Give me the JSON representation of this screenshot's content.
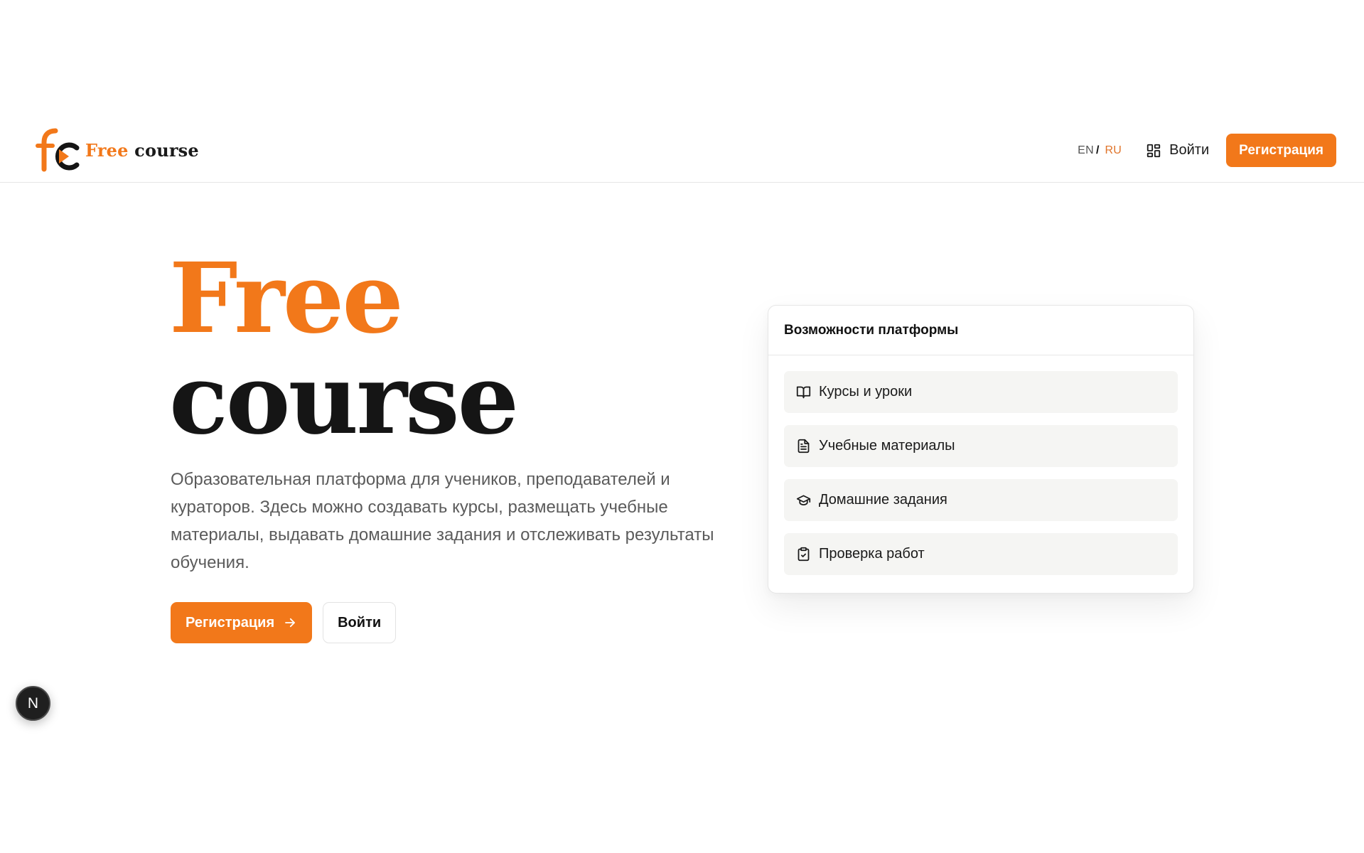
{
  "colors": {
    "accent": "#f2781a",
    "text": "#1a1a1a",
    "muted": "#5b5b5b",
    "border": "#e6e6e6",
    "feature_bg": "#f5f5f3"
  },
  "header": {
    "logo": {
      "word1": "Free",
      "word2": "course",
      "icon": "fc-logo-icon"
    },
    "lang": {
      "en": "EN",
      "separator": "/",
      "ru": "RU",
      "active": "RU"
    },
    "login": {
      "label": "Войти",
      "icon": "dashboard-grid-icon"
    },
    "register_label": "Регистрация"
  },
  "hero": {
    "title_line1": "Free",
    "title_line2": "course",
    "description": "Образовательная платформа для учеников, преподавателей и кураторов. Здесь можно создавать курсы, размещать учебные материалы, выдавать домашние задания и отслеживать результаты обучения.",
    "register_label": "Регистрация",
    "login_label": "Войти"
  },
  "features": {
    "title": "Возможности платформы",
    "items": [
      {
        "label": "Курсы и уроки",
        "icon": "book-open-icon"
      },
      {
        "label": "Учебные материалы",
        "icon": "document-icon"
      },
      {
        "label": "Домашние задания",
        "icon": "graduation-cap-icon"
      },
      {
        "label": "Проверка работ",
        "icon": "clipboard-check-icon"
      }
    ]
  },
  "badge": {
    "label": "N"
  }
}
